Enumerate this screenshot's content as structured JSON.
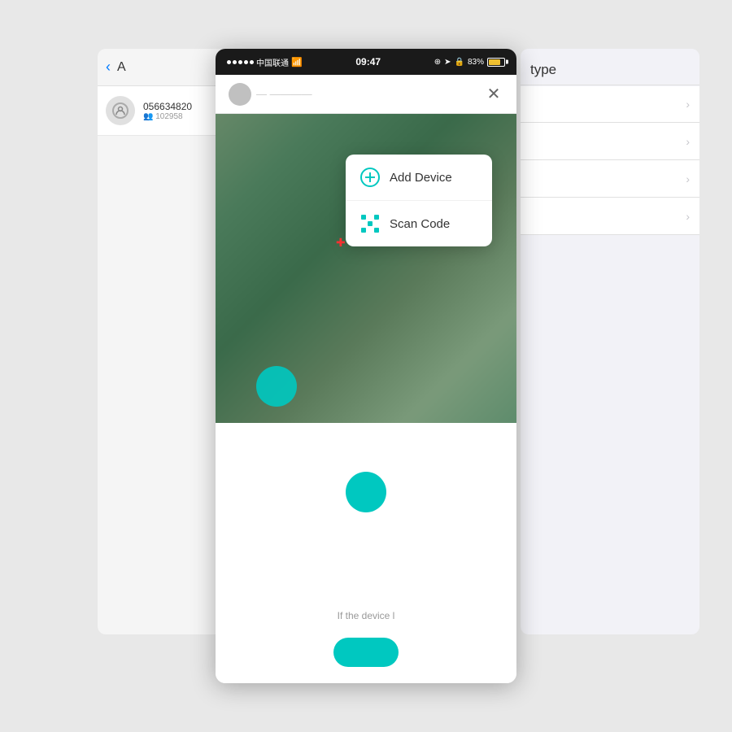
{
  "page": {
    "background_color": "#e8e8e8"
  },
  "bg_left": {
    "back_label": "‹",
    "title": "A",
    "item": {
      "id": "056634820",
      "sub": "👥 102958"
    }
  },
  "bg_right": {
    "title": "type",
    "rows": [
      "",
      "",
      "",
      ""
    ]
  },
  "status_bar": {
    "carrier": "中国联通",
    "wifi_icon": "📶",
    "time": "09:47",
    "battery_percent": "83%"
  },
  "nav_bar": {
    "close_icon": "✕",
    "avatar_placeholder": ""
  },
  "dropdown": {
    "add_device_label": "Add Device",
    "scan_code_label": "Scan Code"
  },
  "bottom": {
    "hint_text": "If the device l",
    "button_label": ""
  },
  "colors": {
    "teal": "#00c8c0",
    "accent": "#007aff"
  }
}
